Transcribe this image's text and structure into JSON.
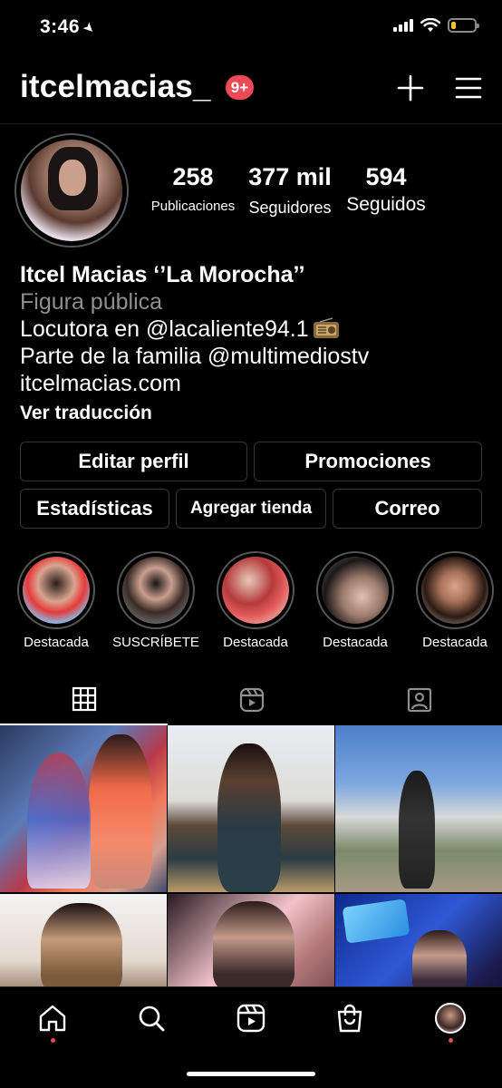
{
  "status_bar": {
    "time": "3:46",
    "location_arrow": "location-arrow-icon",
    "battery_level_fraction": 0.18
  },
  "header": {
    "username": "itcelmacias_",
    "notification_badge": "9+",
    "icons": [
      "plus-icon",
      "menu-icon"
    ]
  },
  "profile": {
    "stats": {
      "posts_count": "258",
      "posts_label": "Publicaciones",
      "followers_count": "377 mil",
      "followers_label": "Seguidores",
      "following_count": "594",
      "following_label": "Seguidos"
    },
    "bio": {
      "name": "Itcel Macias ‘’La Morocha’’",
      "category": "Figura pública",
      "line1": "Locutora en @lacaliente94.1",
      "line2": "Parte de la familia @multimediostv",
      "website": "itcelmacias.com",
      "translate": "Ver traducción"
    }
  },
  "buttons": {
    "edit_profile": "Editar perfil",
    "promotions": "Promociones",
    "insights": "Estadísticas",
    "add_shop": "Agregar tienda",
    "email": "Correo"
  },
  "highlights": [
    {
      "label": "Destacada"
    },
    {
      "label": "SUSCRÍBETE"
    },
    {
      "label": "Destacada"
    },
    {
      "label": "Destacada"
    },
    {
      "label": "Destacada"
    }
  ],
  "tabs": [
    "grid-icon",
    "reels-icon",
    "tagged-icon"
  ],
  "bottom_nav": [
    "home-icon",
    "search-icon",
    "reels-icon",
    "shop-icon",
    "profile-avatar"
  ],
  "colors": {
    "background": "#000000",
    "secondary_text": "#8e8e8e",
    "badge": "#ed4956",
    "border": "#363636"
  }
}
